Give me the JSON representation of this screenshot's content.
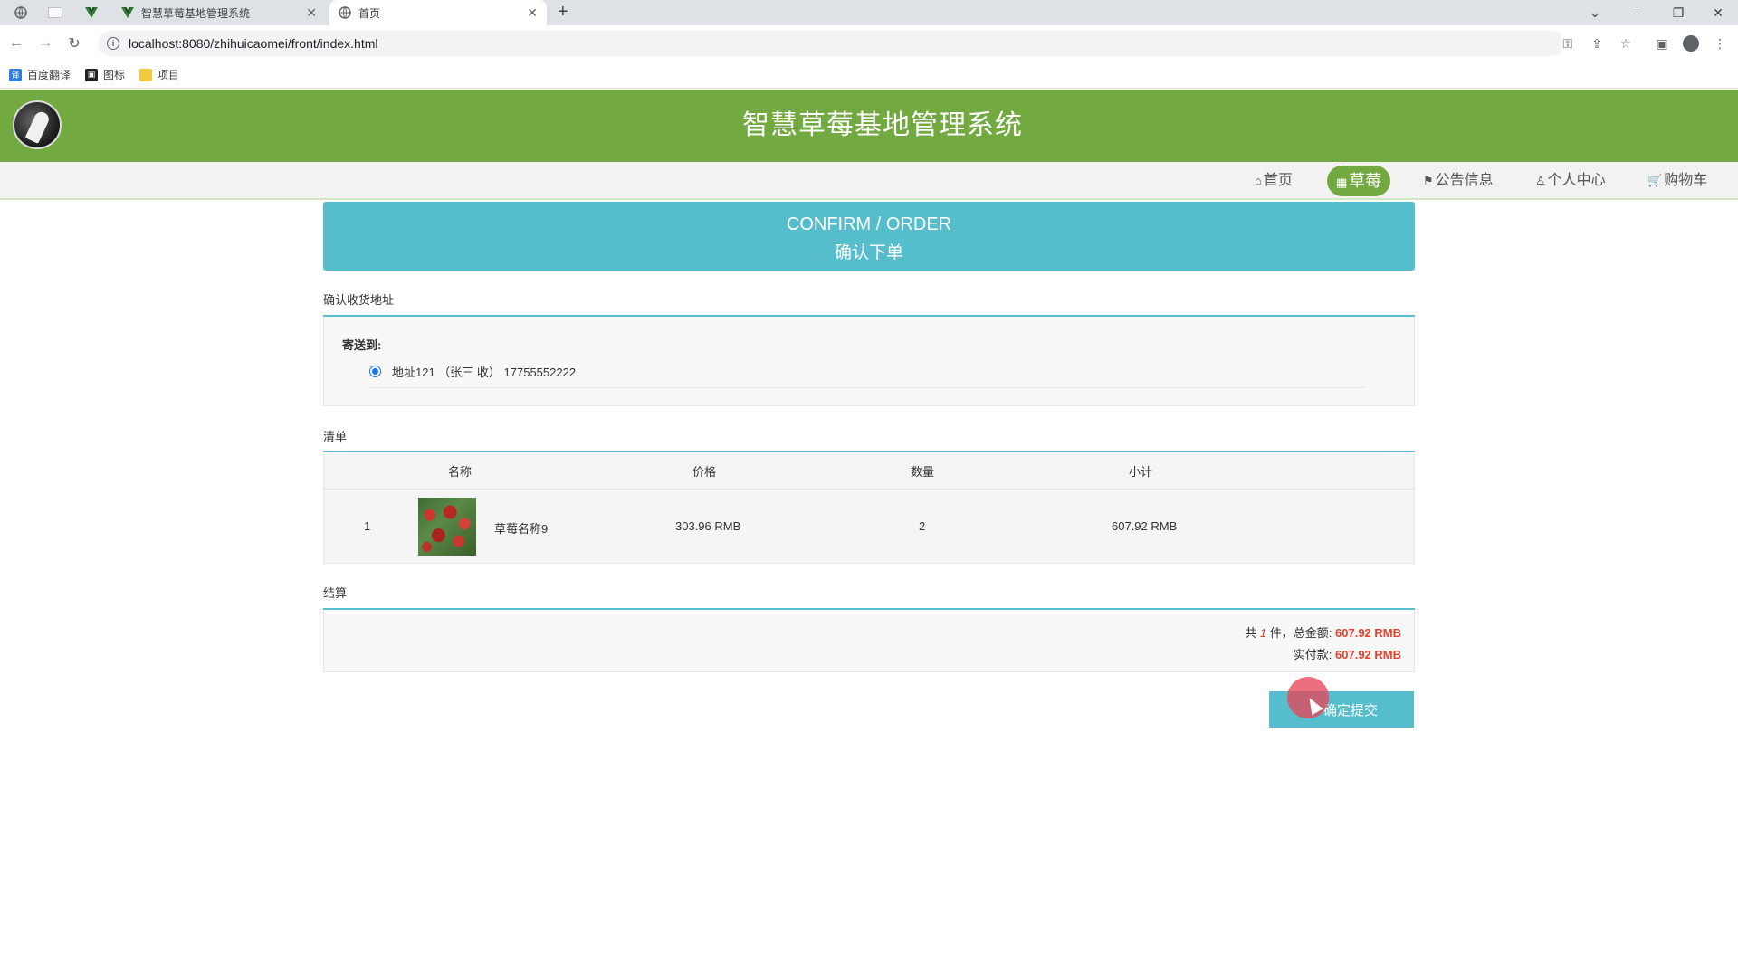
{
  "browser": {
    "tabs": [
      {
        "title": "智慧草莓基地管理系统",
        "active": false
      },
      {
        "title": "首页",
        "active": true
      }
    ],
    "url": "localhost:8080/zhihuicaomei/front/index.html",
    "bookmarks": [
      "百度翻译",
      "图标",
      "项目"
    ]
  },
  "site": {
    "title": "智慧草莓基地管理系统",
    "nav": [
      {
        "label": "首页",
        "icon": "home-icon"
      },
      {
        "label": "草莓",
        "icon": "grid-icon",
        "active": true
      },
      {
        "label": "公告信息",
        "icon": "flag-icon"
      },
      {
        "label": "个人中心",
        "icon": "user-icon"
      },
      {
        "label": "购物车",
        "icon": "cart-icon"
      }
    ]
  },
  "banner": {
    "en": "CONFIRM / ORDER",
    "cn": "确认下单"
  },
  "address": {
    "section_title": "确认收货地址",
    "label": "寄送到:",
    "entry": "地址121 （张三 收） 17755552222"
  },
  "list": {
    "section_title": "清单",
    "headers": [
      "名称",
      "价格",
      "数量",
      "小计"
    ],
    "rows": [
      {
        "index": "1",
        "name": "草莓名称9",
        "price": "303.96 RMB",
        "qty": "2",
        "subtotal": "607.92 RMB"
      }
    ]
  },
  "settle": {
    "section_title": "结算",
    "count_prefix": "共",
    "count": "1",
    "count_suffix": "件，总金额:",
    "total": "607.92 RMB",
    "paid_label": "实付款:",
    "paid": "607.92 RMB"
  },
  "submit_label": "确定提交",
  "colors": {
    "header_green": "#72a940",
    "accent_teal": "#56bdcc",
    "price_red": "#e2402a"
  }
}
